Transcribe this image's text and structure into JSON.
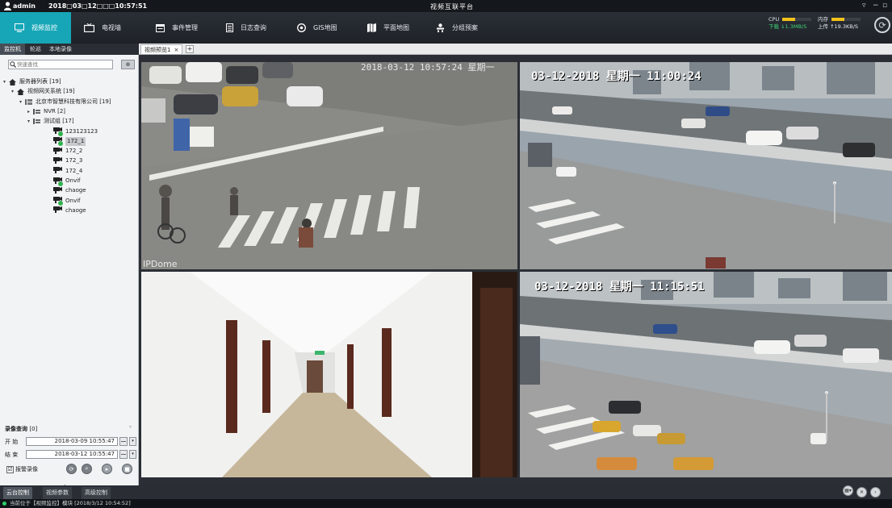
{
  "titlebar": {
    "username": "admin",
    "datetime": "2018□03□12□□□10:57:51",
    "app_title": "视频互联平台",
    "controls": [
      "▿",
      "−",
      "▫"
    ]
  },
  "menu": [
    {
      "label": "视频监控",
      "icon": "monitor-icon",
      "active": true
    },
    {
      "label": "电视墙",
      "icon": "tv-wall-icon"
    },
    {
      "label": "事件管理",
      "icon": "event-icon"
    },
    {
      "label": "日志查询",
      "icon": "log-icon"
    },
    {
      "label": "GIS地图",
      "icon": "gis-icon"
    },
    {
      "label": "平面地图",
      "icon": "floor-map-icon"
    },
    {
      "label": "分组预案",
      "icon": "group-plan-icon"
    }
  ],
  "sysmon": {
    "cpu_label": "CPU",
    "mem_label": "内存",
    "download": "下载 ↓1.3MB/S",
    "upload": "上传 ↑19.3KB/S",
    "cpu_level": 0.45,
    "mem_level": 0.45
  },
  "sidebar": {
    "tabs": [
      "监控机",
      "轮巡",
      "本地录像"
    ],
    "search_placeholder": "快速查找",
    "filter_label": "⊕",
    "tree": [
      {
        "label": "服务器列表 [19]",
        "level": 0,
        "icon": "home-icon",
        "caret": "▾"
      },
      {
        "label": "视频网关系统 [19]",
        "level": 1,
        "icon": "home-icon",
        "caret": "▾"
      },
      {
        "label": "北京市智慧科技有限公司 [19]",
        "level": 2,
        "icon": "org-icon",
        "caret": "▾"
      },
      {
        "label": "NVR [2]",
        "level": 3,
        "icon": "group-icon",
        "caret": "▸"
      },
      {
        "label": "测试组 [17]",
        "level": 3,
        "icon": "group-icon",
        "caret": "▾"
      },
      {
        "label": "123123123",
        "level": 4,
        "icon": "camera-icon",
        "online": true
      },
      {
        "label": "172_1",
        "level": 4,
        "icon": "camera-icon",
        "online": true,
        "selected": true
      },
      {
        "label": "172_2",
        "level": 4,
        "icon": "camera-icon"
      },
      {
        "label": "172_3",
        "level": 4,
        "icon": "camera-icon"
      },
      {
        "label": "172_4",
        "level": 4,
        "icon": "camera-icon"
      },
      {
        "label": "Onvif",
        "level": 4,
        "icon": "camera-icon",
        "online": true
      },
      {
        "label": "chaoge",
        "level": 4,
        "icon": "camera-icon"
      },
      {
        "label": "Onvif",
        "level": 4,
        "icon": "camera-icon",
        "online": true
      },
      {
        "label": "chaoge",
        "level": 4,
        "icon": "camera-icon"
      }
    ]
  },
  "record_query": {
    "title": "录像查询",
    "count": "[0]",
    "start_label": "开 始",
    "start_value": "2018-03-09 10:55:47",
    "end_label": "结 束",
    "end_value": "2018-03-12 10:55:47",
    "alarm_label": "报警录像",
    "alarm_checked": "☑",
    "buttons": [
      "⟳",
      "⌕",
      "▸",
      "■"
    ]
  },
  "view_tab": {
    "label": "视频预览1",
    "close": "×",
    "add": "+"
  },
  "panes": [
    {
      "osd": "2018-03-12 10:57:24 星期一",
      "watermark": "IPDome"
    },
    {
      "osd": "03-12-2018 星期一 11:00:24"
    },
    {
      "osd": ""
    },
    {
      "osd": "03-12-2018 星期一 11:15:51"
    }
  ],
  "bottom_tabs": [
    "云台控制",
    "视频参数",
    "高级控制"
  ],
  "grid_controls": [
    "▦▾",
    "✕",
    "›"
  ],
  "status": "当前位于【视频监控】模块   [2018/3/12 10:54:52]",
  "colors": {
    "accent": "#16a6b7",
    "online": "#2fb34d",
    "meter": "#f2c21b"
  }
}
